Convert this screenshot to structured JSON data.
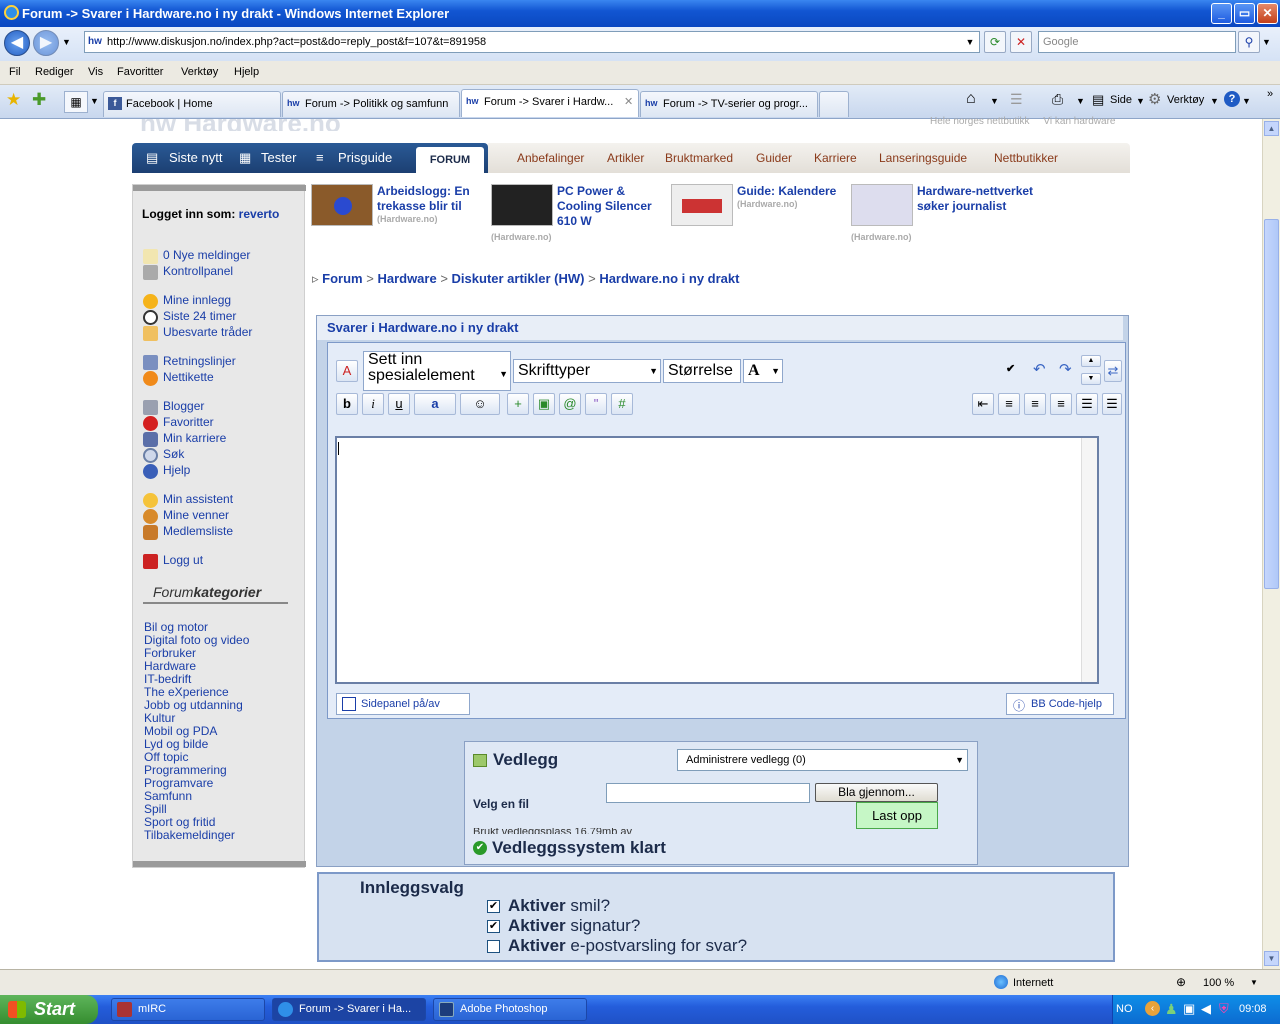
{
  "window": {
    "title": "Forum -> Svarer i Hardware.no i ny drakt - Windows Internet Explorer"
  },
  "address": {
    "url": "http://www.diskusjon.no/index.php?act=post&do=reply_post&f=107&t=891958",
    "search_placeholder": "Google"
  },
  "menu": [
    "Fil",
    "Rediger",
    "Vis",
    "Favoritter",
    "Verktøy",
    "Hjelp"
  ],
  "tabs": [
    {
      "label": "Facebook | Home"
    },
    {
      "label": "Forum -> Politikk og samfunn"
    },
    {
      "label": "Forum -> Svarer i Hardw..."
    },
    {
      "label": "Forum -> TV-serier og progr..."
    }
  ],
  "commandbar": {
    "page": "Side",
    "tools": "Verktøy"
  },
  "site": {
    "top_right": "Hele norges nettbutikk     Vi kan hardware",
    "main_nav": [
      "Siste nytt",
      "Tester",
      "Prisguide"
    ],
    "active_tab": "FORUM",
    "sub_nav": [
      "Anbefalinger",
      "Artikler",
      "Bruktmarked",
      "Guider",
      "Karriere",
      "Lanseringsguide",
      "Nettbutikker"
    ]
  },
  "sidebar": {
    "logged_in_label": "Logget inn som:",
    "username": "reverto",
    "links1": [
      "0 Nye meldinger",
      "Kontrollpanel"
    ],
    "links2": [
      "Mine innlegg",
      "Siste 24 timer",
      "Ubesvarte tråder"
    ],
    "links3": [
      "Retningslinjer",
      "Nettikette"
    ],
    "links4": [
      "Blogger",
      "Favoritter",
      "Min karriere",
      "Søk",
      "Hjelp"
    ],
    "links5": [
      "Min assistent",
      "Mine venner",
      "Medlemsliste"
    ],
    "logout": "Logg ut",
    "cat_heading_a": "Forum",
    "cat_heading_b": "kategorier",
    "categories": [
      "Bil og motor",
      "Digital foto og video",
      "Forbruker",
      "Hardware",
      "IT-bedrift",
      "The eXperience",
      "Jobb og utdanning",
      "Kultur",
      "Mobil og PDA",
      "Lyd og bilde",
      "Off topic",
      "Programmering",
      "Programvare",
      "Samfunn",
      "Spill",
      "Sport og fritid",
      "Tilbakemeldinger"
    ]
  },
  "news": [
    {
      "title": "Arbeidslogg: En trekasse blir til",
      "source": "(Hardware.no)"
    },
    {
      "title": "PC Power & Cooling Silencer 610 W",
      "source": "(Hardware.no)"
    },
    {
      "title": "Guide: Kalendere",
      "source": "(Hardware.no)"
    },
    {
      "title": "Hardware-nettverket søker journalist",
      "source": "(Hardware.no)"
    }
  ],
  "breadcrumb": [
    "Forum",
    "Hardware",
    "Diskuter artikler (HW)",
    "Hardware.no i ny drakt"
  ],
  "post": {
    "heading": "Svarer i Hardware.no i ny drakt",
    "special_select": "Sett inn spesialelement",
    "font_select": "Skrifttyper",
    "size_select": "Størrelse",
    "sidepanel_btn": "Sidepanel på/av",
    "bbcode_btn": "BB Code-hjelp"
  },
  "attachments": {
    "title": "Vedlegg",
    "manage_select": "Administrere vedlegg (0)",
    "file_label": "Velg en fil",
    "browse_btn": "Bla gjennom...",
    "upload_btn": "Last opp",
    "used_space": "Brukt vedleggsplass 16,79mb av",
    "status": "Vedleggssystem klart"
  },
  "options": {
    "title": "Innleggsvalg",
    "items": [
      {
        "bold": "Aktiver",
        "rest": " smil?",
        "checked": true
      },
      {
        "bold": "Aktiver",
        "rest": " signatur?",
        "checked": true
      },
      {
        "bold": "Aktiver",
        "rest": " e-postvarsling for svar?",
        "checked": false
      }
    ]
  },
  "status": {
    "zone": "Internett",
    "zoom": "100 %"
  },
  "taskbar": {
    "start": "Start",
    "tasks": [
      "mIRC",
      "Forum -> Svarer i Ha...",
      "Adobe Photoshop"
    ],
    "lang": "NO",
    "clock": "09:08"
  },
  "colors": {
    "accent": "#1a3ea8",
    "nav_blue": "#1c3f72",
    "upload_green": "#c6f7c6"
  }
}
